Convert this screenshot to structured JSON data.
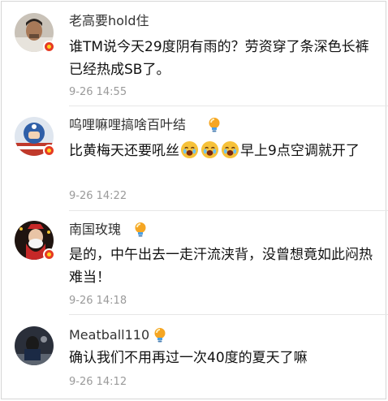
{
  "comments": [
    {
      "username": "老高要hold住",
      "text": "谁TM说今天29度阴有雨的？劳资穿了条深色长裤已经热成SB了。",
      "time": "9-26 14:55",
      "has_bulb": false,
      "verified": true
    },
    {
      "username": "呜哩嘛哩搞啥百叶结",
      "text_before": "比黄梅天还要吼丝",
      "emoji": [
        "crying-face-emoji",
        "crying-face-emoji",
        "crying-face-emoji"
      ],
      "text_after": "早上9点空调就开了",
      "time": "9-26 14:22",
      "has_bulb": true,
      "verified": true
    },
    {
      "username": "南国玫瑰",
      "text": "是的，中午出去一走汗流浃背，没曾想竟如此闷热难当！",
      "time": "9-26 14:18",
      "has_bulb": true,
      "verified": true
    },
    {
      "username": "Meatball110",
      "text": "确认我们不用再过一次40度的夏天了嘛",
      "time": "9-26 14:12",
      "has_bulb": true,
      "verified": false
    }
  ],
  "colors": {
    "badge": "#e53a24",
    "timestamp": "#9a9a9a",
    "divider": "#e6e6e6"
  }
}
